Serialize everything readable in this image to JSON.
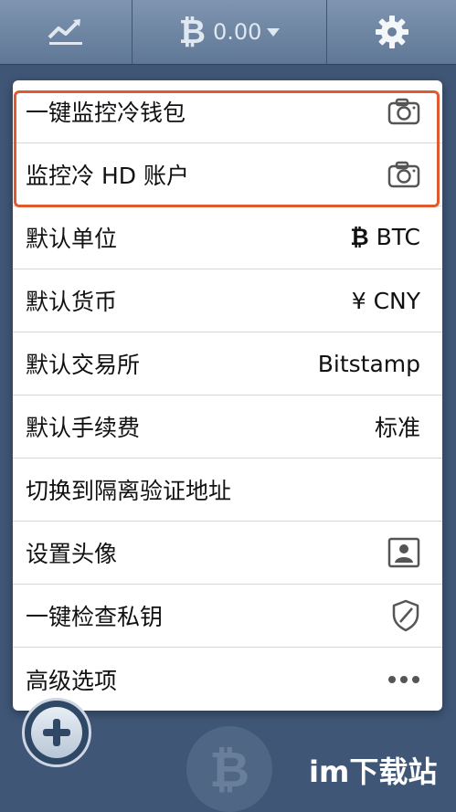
{
  "topbar": {
    "balance": "0.00",
    "chart_icon": "trend-chart-icon",
    "currency_icon": "bitcoin-icon",
    "settings_icon": "gear-icon"
  },
  "menu": {
    "items": [
      {
        "label": "一键监控冷钱包",
        "icon": "camera-icon"
      },
      {
        "label": "监控冷 HD 账户",
        "icon": "camera-icon"
      },
      {
        "label": "默认单位",
        "value": "BTC",
        "icon": "bitcoin-icon"
      },
      {
        "label": "默认货币",
        "value": "¥ CNY"
      },
      {
        "label": "默认交易所",
        "value": "Bitstamp"
      },
      {
        "label": "默认手续费",
        "value": "标准"
      },
      {
        "label": "切换到隔离验证地址"
      },
      {
        "label": "设置头像",
        "icon": "portrait-icon"
      },
      {
        "label": "一键检查私钥",
        "icon": "shield-icon"
      },
      {
        "label": "高级选项",
        "icon": "more-dots-icon"
      }
    ]
  },
  "highlight_color": "#e05a2f",
  "watermark": "im下载站"
}
